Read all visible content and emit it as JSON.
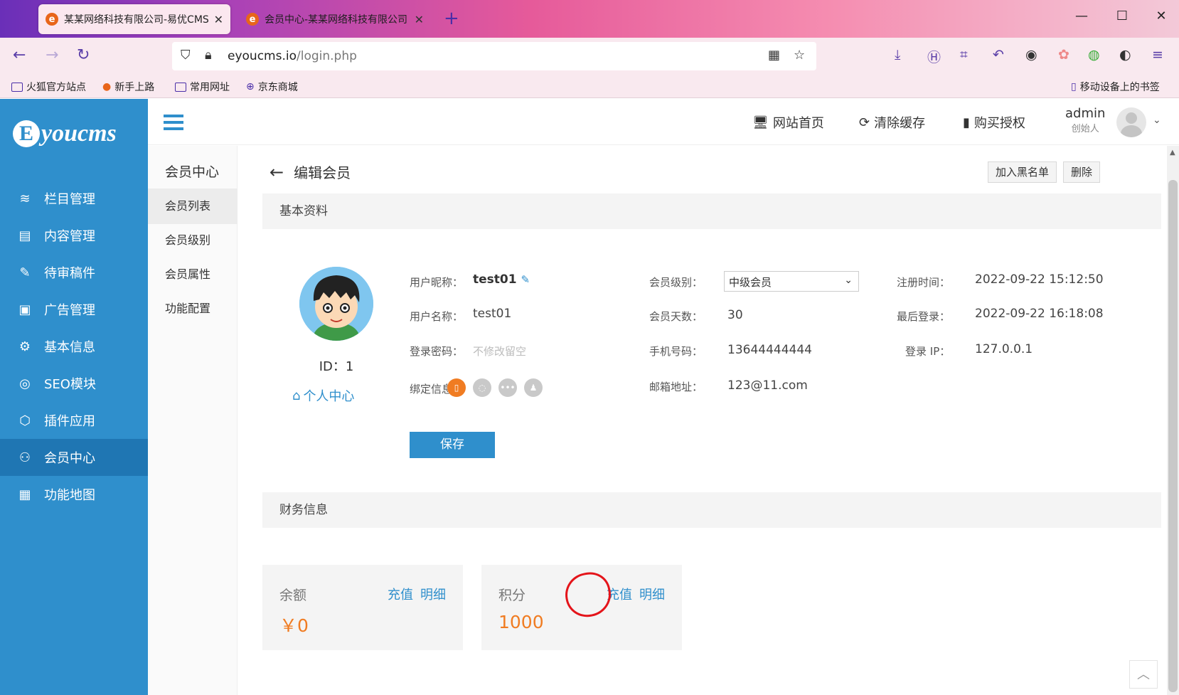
{
  "browser": {
    "tabs": [
      {
        "title": "某某网络科技有限公司-易优CMS",
        "active": true
      },
      {
        "title": "会员中心-某某网络科技有限公司",
        "active": false
      }
    ],
    "url_domain": "eyoucms.io",
    "url_path": "/login.php",
    "bookmarks": [
      "火狐官方站点",
      "新手上路",
      "常用网址",
      "京东商城"
    ],
    "mobile_bookmarks": "移动设备上的书签"
  },
  "sidebar": {
    "logo_text": "youcms",
    "logo_mark": "E",
    "items": [
      {
        "label": "栏目管理",
        "icon": "layers-icon"
      },
      {
        "label": "内容管理",
        "icon": "document-icon"
      },
      {
        "label": "待审稿件",
        "icon": "review-icon"
      },
      {
        "label": "广告管理",
        "icon": "ad-icon"
      },
      {
        "label": "基本信息",
        "icon": "gear-icon"
      },
      {
        "label": "SEO模块",
        "icon": "seo-icon"
      },
      {
        "label": "插件应用",
        "icon": "cube-icon"
      },
      {
        "label": "会员中心",
        "icon": "user-icon",
        "active": true
      },
      {
        "label": "功能地图",
        "icon": "grid-icon"
      }
    ]
  },
  "header": {
    "home": "网站首页",
    "clear_cache": "清除缓存",
    "buy_license": "购买授权",
    "user_name": "admin",
    "user_role": "创始人"
  },
  "subnav": {
    "title": "会员中心",
    "items": [
      "会员列表",
      "会员级别",
      "会员属性",
      "功能配置"
    ]
  },
  "main": {
    "page_title": "编辑会员",
    "blacklist_btn": "加入黑名单",
    "delete_btn": "删除",
    "basic_section": "基本资料",
    "finance_section": "财务信息",
    "id_label": "ID：1",
    "personal_center": "个人中心",
    "fields": {
      "nickname_label": "用户昵称：",
      "nickname": "test01",
      "username_label": "用户名称：",
      "username": "test01",
      "password_label": "登录密码：",
      "password_placeholder": "不修改留空",
      "bind_label": "绑定信息：",
      "level_label": "会员级别：",
      "level": "中级会员",
      "days_label": "会员天数：",
      "days": "30",
      "phone_label": "手机号码：",
      "phone": "13644444444",
      "email_label": "邮箱地址：",
      "email": "123@11.com",
      "reg_label": "注册时间：",
      "reg_time": "2022-09-22 15:12:50",
      "last_label": "最后登录：",
      "last_login": "2022-09-22 16:18:08",
      "ip_label": "登录 IP：",
      "ip": "127.0.0.1"
    },
    "save_btn": "保存",
    "balance": {
      "label": "余额",
      "recharge": "充值",
      "detail": "明细",
      "amount": "￥0"
    },
    "points": {
      "label": "积分",
      "recharge": "充值",
      "detail": "明细",
      "amount": "1000"
    }
  },
  "colors": {
    "accent": "#2f8fcc",
    "amount": "#f07c22",
    "annotation": "#e4141a"
  }
}
